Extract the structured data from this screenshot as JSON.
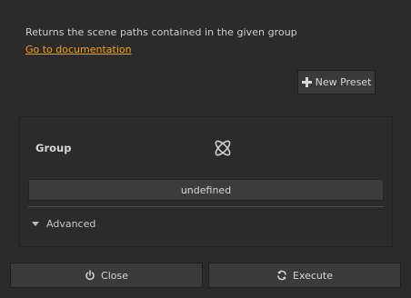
{
  "header": {
    "description": "Returns the scene paths contained in the given group",
    "doc_link": "Go to documentation"
  },
  "toolbar": {
    "new_preset_label": "New Preset",
    "new_preset_icon": "plus-icon"
  },
  "parameters": {
    "group_label": "Group",
    "group_icon": "group-selector-icon",
    "group_value": "undefined",
    "advanced_label": "Advanced"
  },
  "footer": {
    "close_label": "Close",
    "close_icon": "power-icon",
    "execute_label": "Execute",
    "execute_icon": "refresh-icon"
  },
  "colors": {
    "background": "#2b2b2b",
    "link": "#f0a21e",
    "button": "#3a3a3a"
  }
}
